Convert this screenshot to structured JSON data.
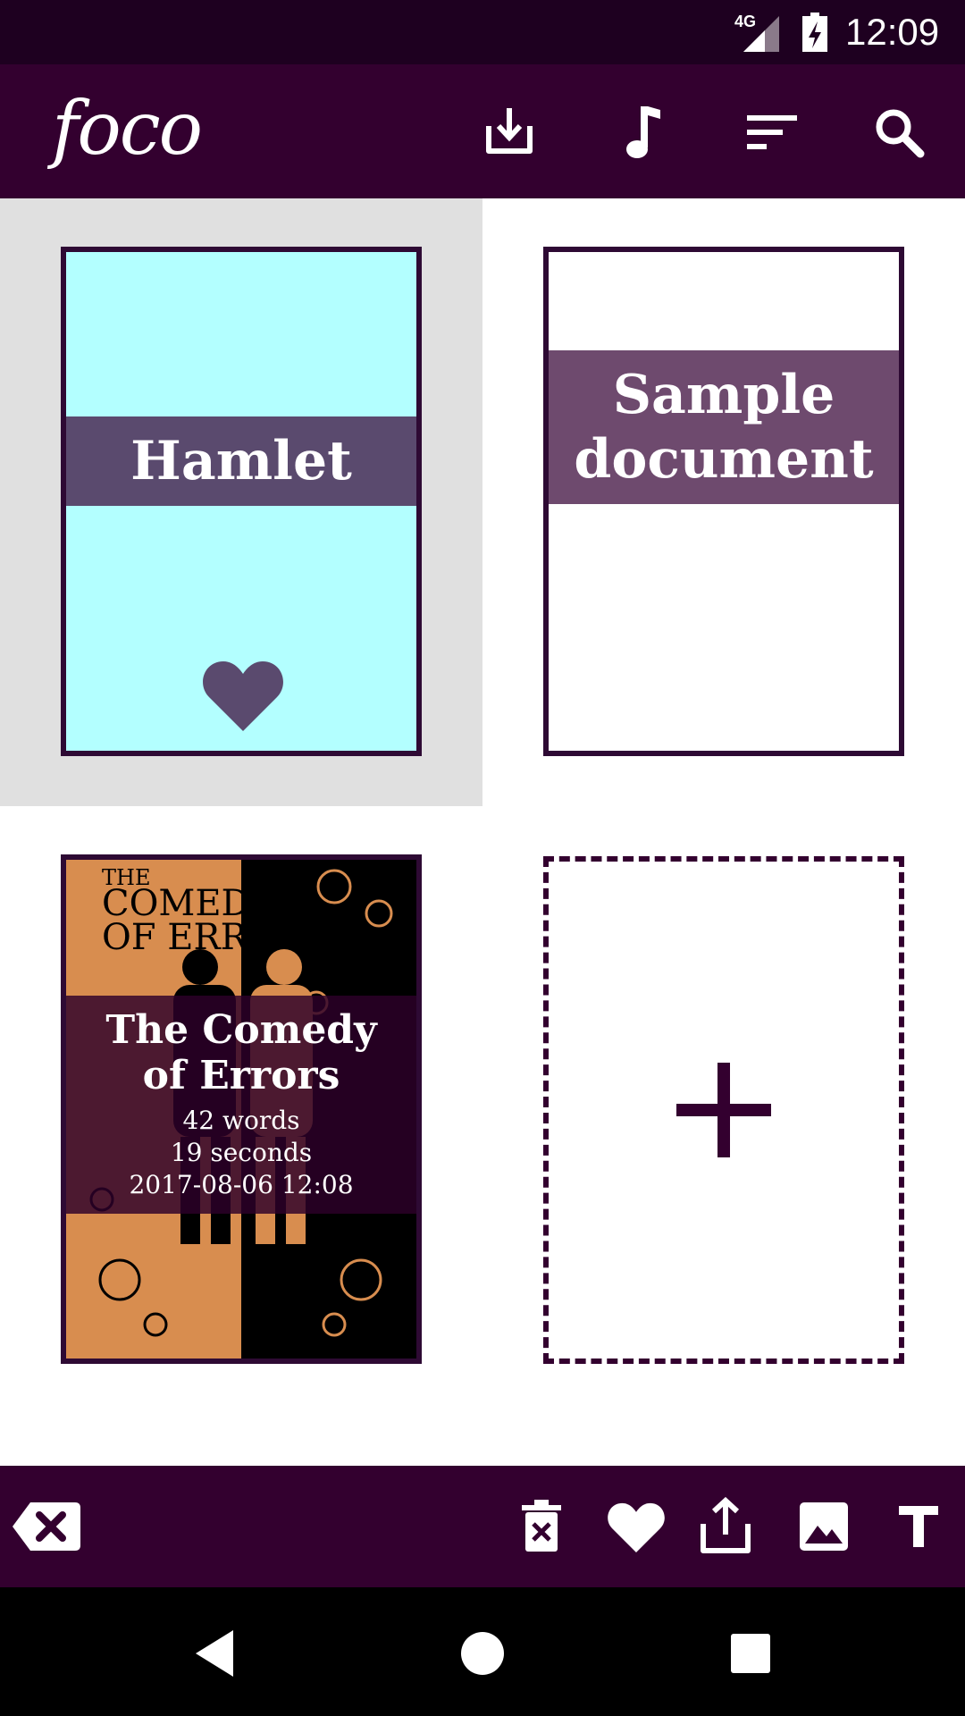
{
  "status_bar": {
    "network": "4G",
    "time": "12:09"
  },
  "app_bar": {
    "logo": "foco",
    "icons": [
      "import-icon",
      "music-icon",
      "sort-icon",
      "search-icon"
    ]
  },
  "documents": [
    {
      "title": "Hamlet",
      "favorite": true,
      "selected": true,
      "background": "#b3ffff",
      "band_color": "#5a4a6e"
    },
    {
      "title": "Sample document",
      "title_lines": [
        "Sample",
        "document"
      ],
      "favorite": false,
      "selected": false,
      "background": "#ffffff",
      "band_color": "#6e4a6e"
    },
    {
      "title": "The Comedy of Errors",
      "title_lines": [
        "The Comedy",
        "of Errors"
      ],
      "cover_text": [
        "THE",
        "COMEDY",
        "OF ERRORS"
      ],
      "words": "42 words",
      "duration": "19 seconds",
      "timestamp": "2017-08-06 12:08",
      "selected": false
    }
  ],
  "add_document": {
    "icon": "plus-icon"
  },
  "bottom_bar": {
    "icons": [
      "backspace-icon",
      "delete-icon",
      "favorite-icon",
      "share-icon",
      "image-icon",
      "text-icon"
    ]
  },
  "nav_bar": {
    "icons": [
      "back-icon",
      "home-icon",
      "recents-icon"
    ]
  },
  "colors": {
    "primary": "#33002f",
    "status": "#1e0020",
    "selected_bg": "#e0e0e0"
  }
}
